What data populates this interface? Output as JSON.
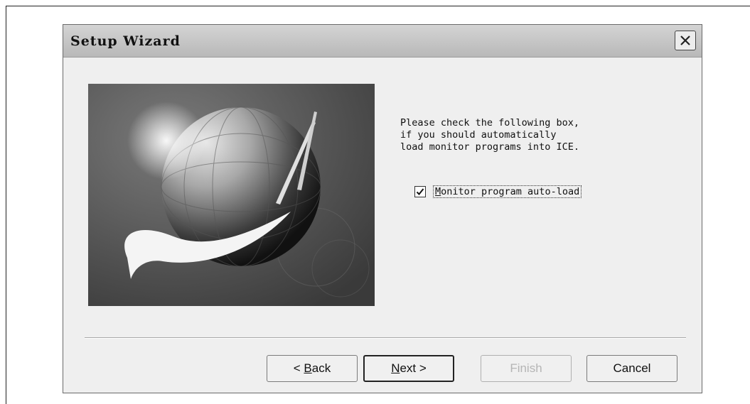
{
  "window": {
    "title": "Setup Wizard",
    "close_icon": "close-icon"
  },
  "instructions": {
    "line1": "Please check the following box,",
    "line2": "if you should automatically",
    "line3": "load monitor programs into ICE."
  },
  "checkbox": {
    "checked": true,
    "mnemonic": "M",
    "label_rest": "onitor program auto-load"
  },
  "buttons": {
    "back": {
      "prefix": "< ",
      "mnemonic": "B",
      "rest": "ack"
    },
    "next": {
      "mnemonic": "N",
      "rest": "ext >"
    },
    "finish": "Finish",
    "cancel": "Cancel"
  },
  "colors": {
    "dialog_bg": "#efefef",
    "title_bar": "#c4c4c4",
    "disabled_text": "#b5b5b5"
  }
}
